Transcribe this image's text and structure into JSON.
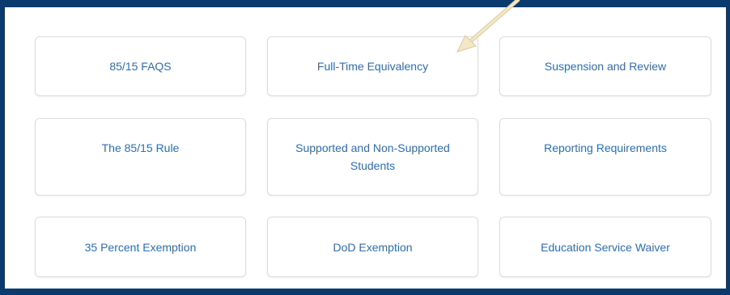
{
  "cards": {
    "row1": [
      {
        "label": "85/15 FAQS"
      },
      {
        "label": "Full-Time Equivalency"
      },
      {
        "label": "Suspension and Review"
      }
    ],
    "row2": [
      {
        "label": "The 85/15 Rule"
      },
      {
        "label": "Supported and Non-Supported Students"
      },
      {
        "label": "Reporting Requirements"
      }
    ],
    "row3": [
      {
        "label": "35 Percent Exemption"
      },
      {
        "label": "DoD Exemption"
      },
      {
        "label": "Education Service Waiver"
      }
    ]
  },
  "colors": {
    "frame": "#0b3a6e",
    "link_text": "#2a6ebb",
    "card_border": "#dcdcdc",
    "arrow": "#f3e7c6"
  },
  "icons": {
    "annotation_arrow": "arrow-pointer-icon"
  }
}
